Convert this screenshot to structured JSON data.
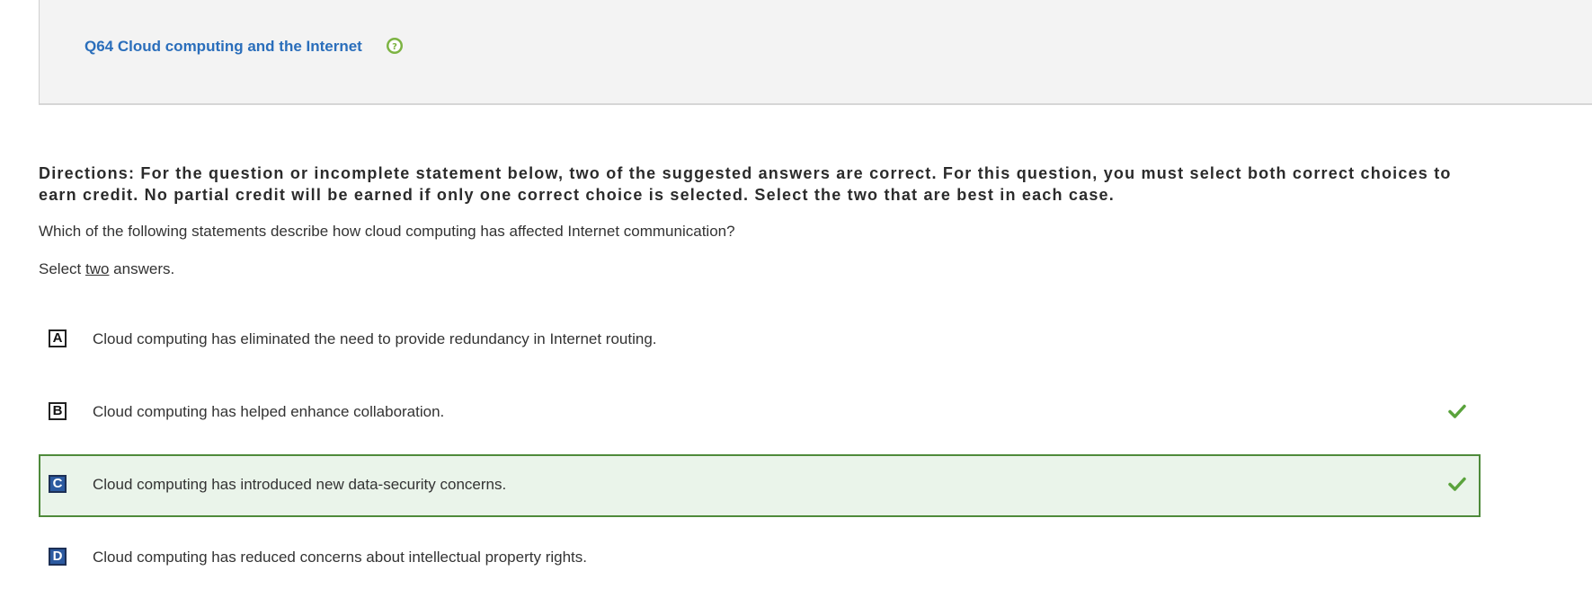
{
  "header": {
    "question_title": "Q64 Cloud computing and the Internet",
    "help_icon": "help-question-icon"
  },
  "directions": "Directions: For the question or incomplete statement below, two of the suggested answers are correct. For this question, you must select both correct choices to earn credit. No partial credit will be earned if only one correct choice is selected. Select the two that are best in each case.",
  "question": "Which of the following statements describe how cloud computing has affected Internet communication?",
  "select_prefix": "Select ",
  "select_count": "two",
  "select_suffix": " answers.",
  "options": [
    {
      "letter": "A",
      "text": "Cloud computing has eliminated the need to provide redundancy in Internet routing.",
      "selected": false,
      "filled": false,
      "correct_mark": false
    },
    {
      "letter": "B",
      "text": "Cloud computing has helped enhance collaboration.",
      "selected": false,
      "filled": false,
      "correct_mark": true
    },
    {
      "letter": "C",
      "text": "Cloud computing has introduced new data-security concerns.",
      "selected": true,
      "filled": true,
      "correct_mark": true
    },
    {
      "letter": "D",
      "text": "Cloud computing has reduced concerns about intellectual property rights.",
      "selected": false,
      "filled": true,
      "correct_mark": false
    }
  ],
  "colors": {
    "title_blue": "#2a6ebb",
    "selected_border": "#4e8a3a",
    "selected_bg": "#eaf4ea",
    "check_green": "#5aa33c",
    "help_green": "#7cb342",
    "letter_filled": "#2c5aa0"
  }
}
